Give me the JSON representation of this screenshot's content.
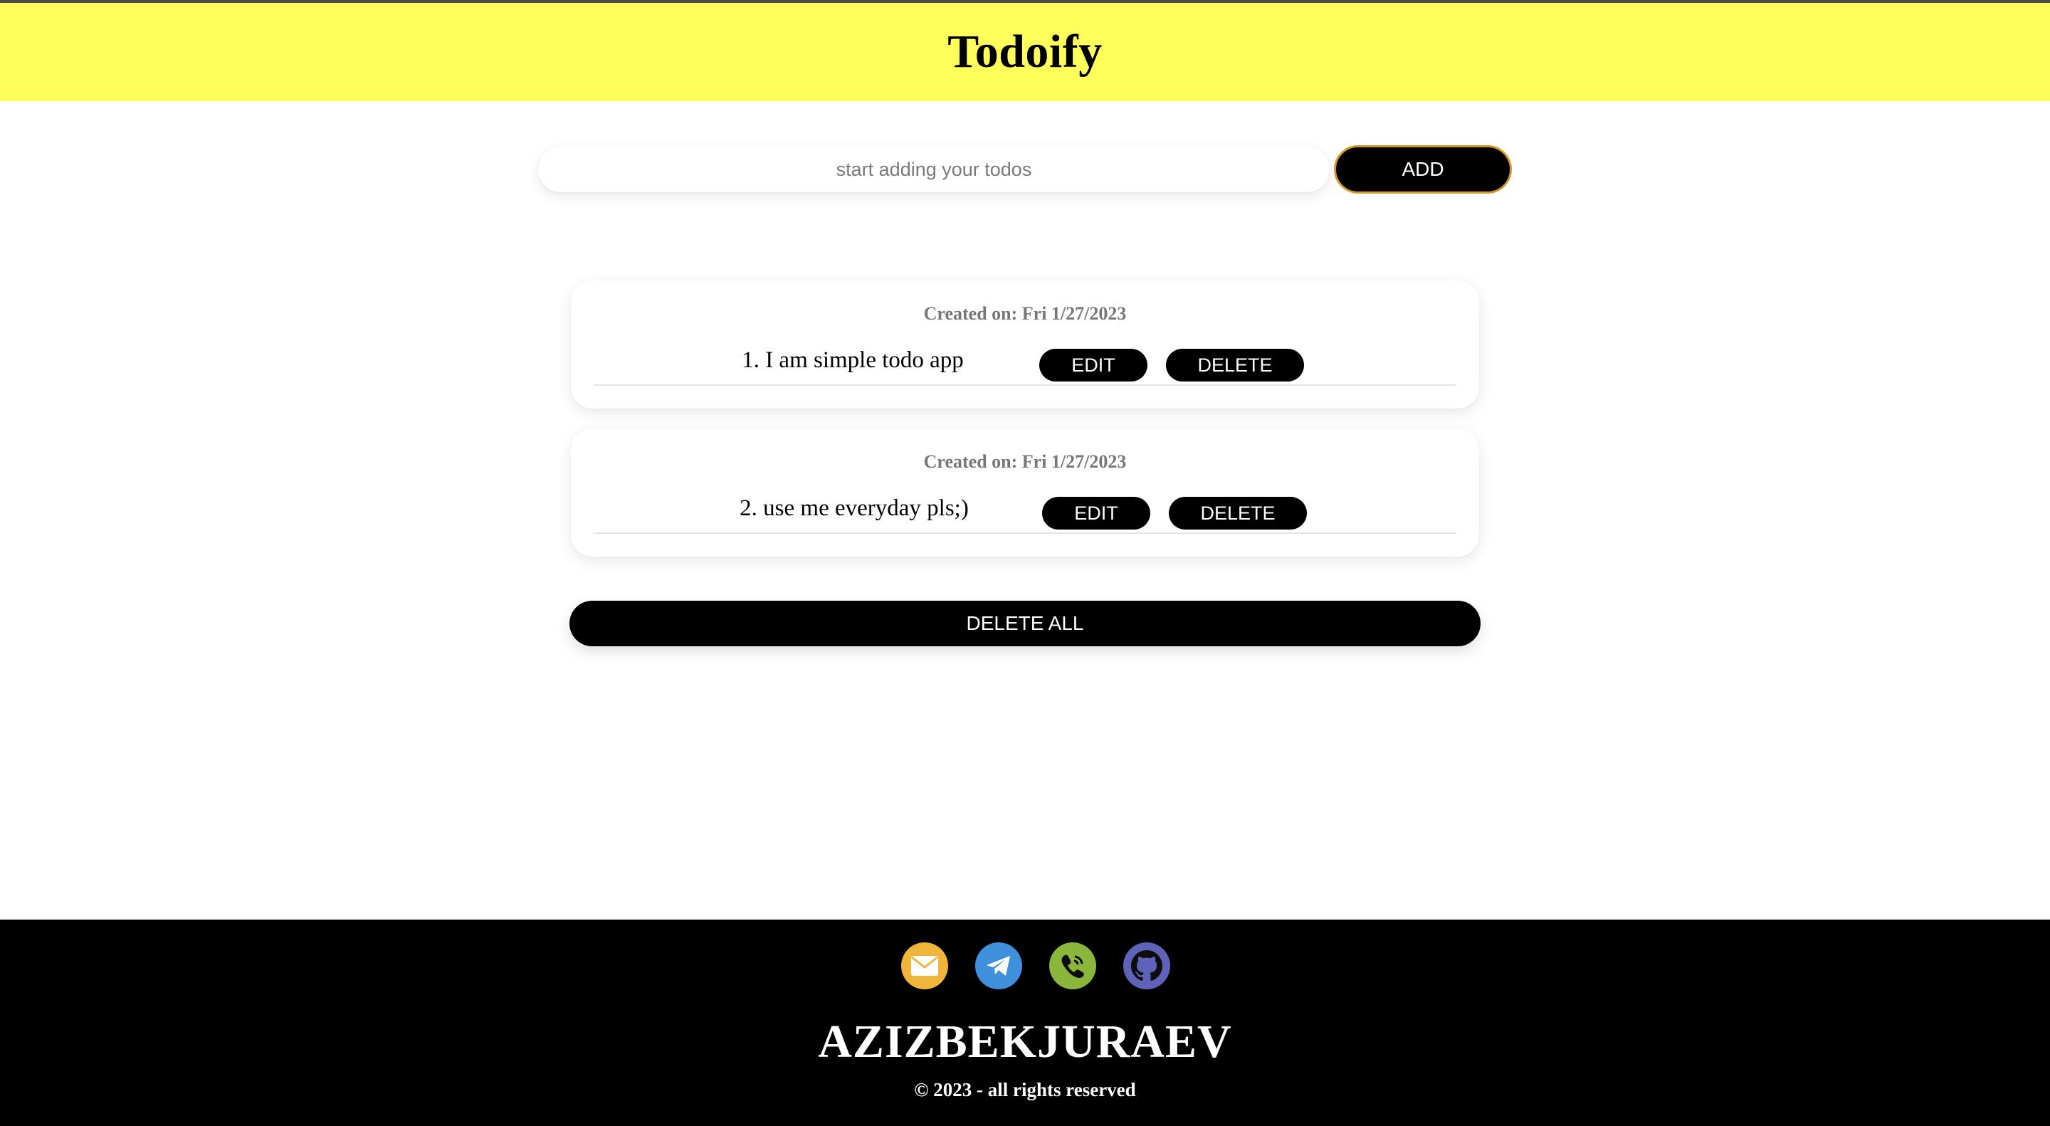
{
  "header": {
    "title": "Todoify"
  },
  "add_form": {
    "placeholder": "start adding your todos",
    "value": "",
    "add_label": "ADD"
  },
  "todos": [
    {
      "created": "Created on: Fri 1/27/2023",
      "text": "1. I am simple todo app",
      "edit_label": "EDIT",
      "delete_label": "DELETE"
    },
    {
      "created": "Created on: Fri 1/27/2023",
      "text": "2. use me everyday pls;)",
      "edit_label": "EDIT",
      "delete_label": "DELETE"
    }
  ],
  "delete_all_label": "DELETE ALL",
  "footer": {
    "socials": [
      {
        "icon": "mail-icon",
        "color": "#f0b53a"
      },
      {
        "icon": "telegram-icon",
        "color": "#3f8fdb"
      },
      {
        "icon": "phone-icon",
        "color": "#8ab63c"
      },
      {
        "icon": "github-icon",
        "color": "#5f63b8"
      }
    ],
    "brand": "AZIZBEKJURAEV",
    "copyright": "© 2023 - all rights reserved"
  },
  "colors": {
    "header_bg": "#ffff5c",
    "add_border": "#d39a2a",
    "footer_bg": "#000000"
  }
}
